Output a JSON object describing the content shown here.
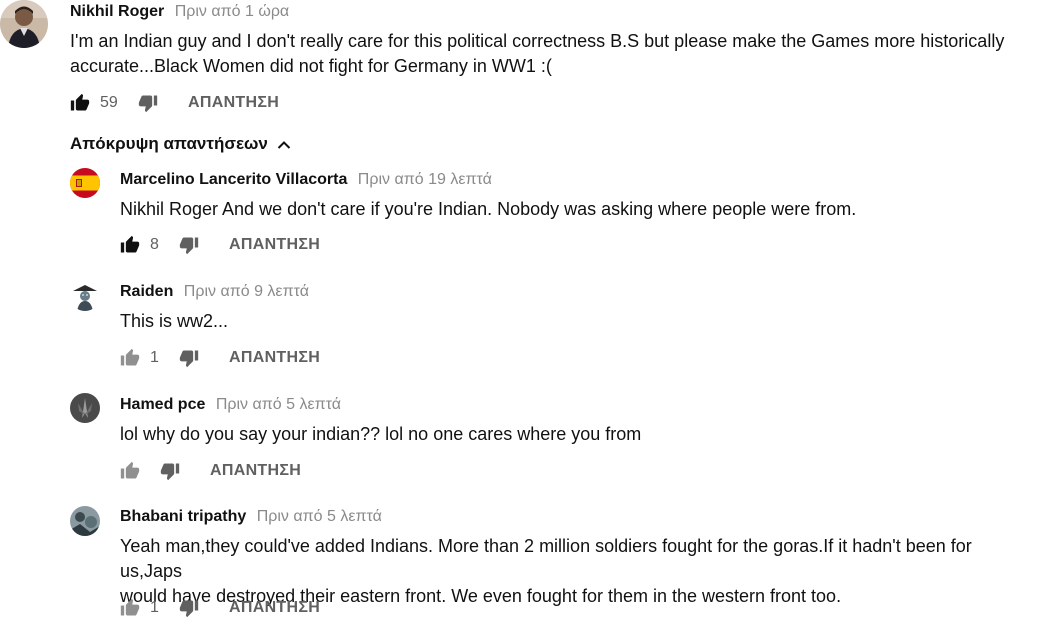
{
  "main_comment": {
    "author": "Nikhil Roger",
    "time": "Πριν από 1 ώρα",
    "text_line1": "I'm an Indian guy and I don't really care for this political correctness B.S but please make the Games more historically",
    "text_line2": "accurate...Black Women did not fight for Germany in WW1 :(",
    "likes": "59",
    "reply_label": "ΑΠΑΝΤΗΣΗ"
  },
  "hide_replies_label": "Απόκρυψη απαντήσεων",
  "replies": [
    {
      "author": "Marcelino Lancerito Villacorta",
      "time": "Πριν από 19 λεπτά",
      "text_line1": "Nikhil Roger And we don't care if you're Indian. Nobody was asking where people were from.",
      "likes": "8",
      "reply_label": "ΑΠΑΝΤΗΣΗ"
    },
    {
      "author": "Raiden",
      "time": "Πριν από 9 λεπτά",
      "text_line1": "This is ww2...",
      "likes": "1",
      "reply_label": "ΑΠΑΝΤΗΣΗ"
    },
    {
      "author": "Hamed pce",
      "time": "Πριν από 5 λεπτά",
      "text_line1": "lol why do you say your indian?? lol no one cares where you from",
      "likes": "",
      "reply_label": "ΑΠΑΝΤΗΣΗ"
    },
    {
      "author": "Bhabani tripathy",
      "time": "Πριν από 5 λεπτά",
      "text_line1": "Yeah man,they could've added Indians. More than 2 million soldiers fought for the goras.If it hadn't been for us,Japs",
      "text_line2": "would have destroyed their eastern front. We even fought for them in the western front too.",
      "likes": "1",
      "reply_label": "ΑΠΑΝΤΗΣΗ"
    }
  ],
  "colors": {
    "text": "#111111",
    "meta": "#8a8a8a",
    "action": "#606060",
    "like_active": "#0f0f0f"
  }
}
